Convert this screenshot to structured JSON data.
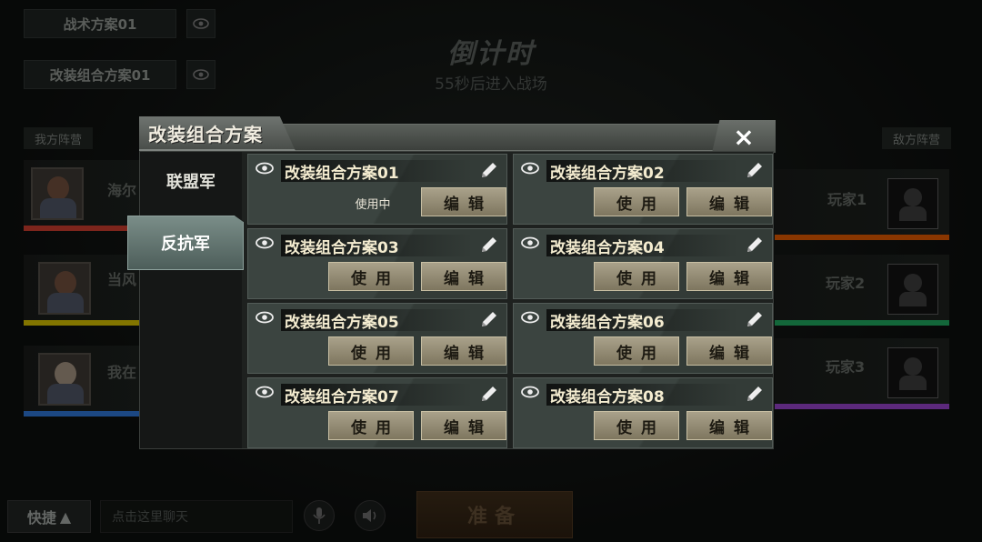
{
  "top_left": {
    "tactic_plan": "战术方案01",
    "mod_plan": "改装组合方案01"
  },
  "countdown": {
    "title": "倒计时",
    "subtitle": "55秒后进入战场"
  },
  "teams": {
    "our_label": "我方阵营",
    "enemy_label": "敌方阵营",
    "our_players": [
      {
        "name": "海尔",
        "bar_color": "#c0392b"
      },
      {
        "name": "当风",
        "bar_color": "#c8b400"
      },
      {
        "name": "我在",
        "bar_color": "#2c6fc9"
      }
    ],
    "enemy_players": [
      {
        "name": "玩家1",
        "bar_color": "#d35400"
      },
      {
        "name": "玩家2",
        "bar_color": "#1e9e5a"
      },
      {
        "name": "玩家3",
        "bar_color": "#8e3fbf"
      }
    ]
  },
  "bottom": {
    "quick_label": "快捷",
    "chat_placeholder": "点击这里聊天",
    "ready_label": "准备"
  },
  "modal": {
    "title": "改装组合方案",
    "close": "×",
    "tabs": [
      {
        "label": "联盟军",
        "active": false
      },
      {
        "label": "反抗军",
        "active": true
      }
    ],
    "use_label": "使用",
    "edit_label": "编辑",
    "in_use_label": "使用中",
    "plans": [
      {
        "name": "改装组合方案01",
        "in_use": true
      },
      {
        "name": "改装组合方案02",
        "in_use": false
      },
      {
        "name": "改装组合方案03",
        "in_use": false
      },
      {
        "name": "改装组合方案04",
        "in_use": false
      },
      {
        "name": "改装组合方案05",
        "in_use": false
      },
      {
        "name": "改装组合方案06",
        "in_use": false
      },
      {
        "name": "改装组合方案07",
        "in_use": false
      },
      {
        "name": "改装组合方案08",
        "in_use": false
      }
    ]
  }
}
